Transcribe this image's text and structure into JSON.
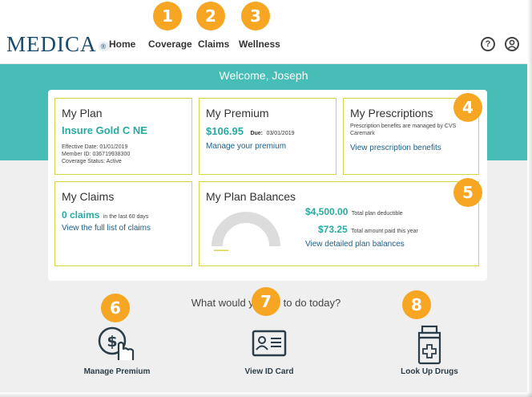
{
  "header": {
    "logo": "MEDICA",
    "logo_mark": "®",
    "nav": {
      "home": "Home",
      "coverage": "Coverage",
      "claims": "Claims",
      "wellness": "Wellness"
    },
    "help_icon": "?",
    "account_icon": "user-icon"
  },
  "banner": {
    "welcome": "Welcome, Joseph"
  },
  "cards": {
    "plan": {
      "title": "My Plan",
      "name": "Insure Gold C NE",
      "effective": "Effective Date: 01/01/2019",
      "member": "Member ID: 036719938300",
      "status": "Coverage Status: Active"
    },
    "premium": {
      "title": "My Premium",
      "amount": "$106.95",
      "due_label": "Due:",
      "due_date": "03/01/2019",
      "link": "Manage your premium"
    },
    "prescriptions": {
      "title": "My Prescriptions",
      "note": "Prescription benefits are managed by CVS Caremark",
      "link": "View prescription benefits"
    },
    "claims": {
      "title": "My Claims",
      "count": "0 claims",
      "count_suffix": "in the last 60 days",
      "link": "View the full list of claims"
    },
    "balances": {
      "title": "My Plan Balances",
      "deductible": "$4,500.00",
      "deductible_label": "Total plan deductible",
      "paid": "$73.25",
      "paid_label": "Total amount paid this year",
      "paid_fraction": 0.016,
      "link": "View detailed plan balances"
    }
  },
  "question": "What would y",
  "question_tail": "e to do today?",
  "actions": {
    "premium": "Manage Premium",
    "idcard": "View ID Card",
    "drugs": "Look Up Drugs"
  },
  "callouts": [
    "1",
    "2",
    "3",
    "4",
    "5",
    "6",
    "7",
    "8"
  ],
  "colors": {
    "teal": "#46bdb6",
    "accent": "#f6a623",
    "card_border": "#d7d545",
    "navy": "#1a4a6b"
  }
}
